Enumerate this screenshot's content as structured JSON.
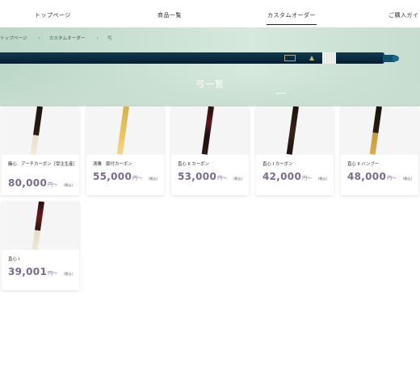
{
  "nav": {
    "items": [
      "トップページ",
      "商品一覧",
      "カスタムオーダー",
      "ご購入ガイド"
    ],
    "active_index": 2
  },
  "breadcrumb": {
    "items": [
      "トップページ",
      "カスタムオーダー",
      "弓"
    ],
    "separator": "›"
  },
  "hero": {
    "title": "弓一覧"
  },
  "products": [
    {
      "name": "簸心　アーチカーボン［受注生産］",
      "price": "80,000",
      "unit": "円〜",
      "tax": "（税込）"
    },
    {
      "name": "清雅　節付カーボン",
      "price": "55,000",
      "unit": "円〜",
      "tax": "（税込）"
    },
    {
      "name": "直心 II カーボン",
      "price": "53,000",
      "unit": "円〜",
      "tax": "（税込）"
    },
    {
      "name": "直心 I カーボン",
      "price": "42,000",
      "unit": "円〜",
      "tax": "（税込）"
    },
    {
      "name": "直心 II バンブー",
      "price": "48,000",
      "unit": "円〜",
      "tax": "（税込）"
    },
    {
      "name": "直心 I",
      "price": "39,001",
      "unit": "円〜",
      "tax": "（税込）"
    }
  ],
  "colors": {
    "accent_price": "#7c6a8e",
    "hero_green": "#cde3d5",
    "bow_navy": "#0a2b3f"
  }
}
